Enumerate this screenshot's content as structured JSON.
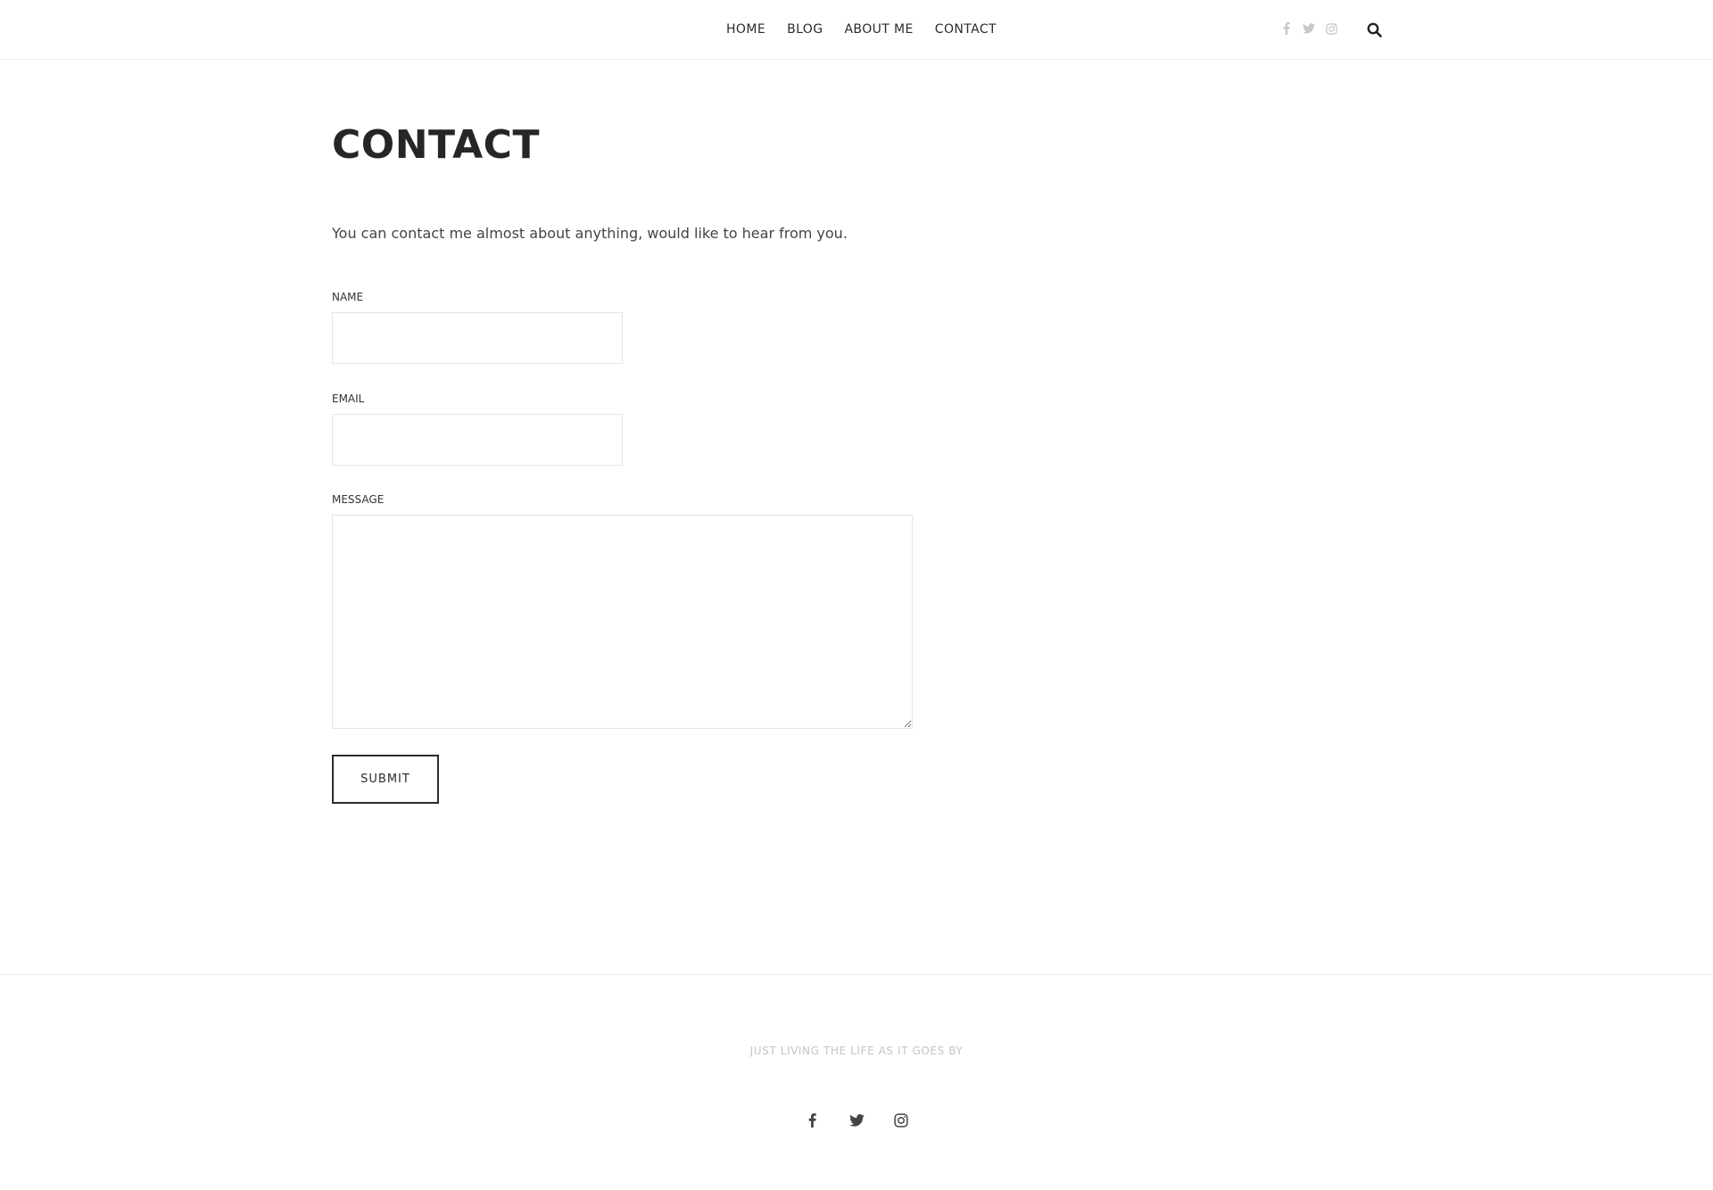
{
  "header": {
    "nav": [
      {
        "label": "HOME"
      },
      {
        "label": "BLOG"
      },
      {
        "label": "ABOUT ME"
      },
      {
        "label": "CONTACT"
      }
    ],
    "social_icons": [
      "facebook-icon",
      "twitter-icon",
      "instagram-icon"
    ],
    "search_icon": "search-icon"
  },
  "main": {
    "title": "CONTACT",
    "intro": "You can contact me almost about anything, would like to hear from you.",
    "form": {
      "name_label": "NAME",
      "name_value": "",
      "email_label": "EMAIL",
      "email_value": "",
      "message_label": "MESSAGE",
      "message_value": "",
      "submit_label": "SUBMIT"
    }
  },
  "footer": {
    "tagline": "JUST LIVING THE LIFE AS IT GOES BY",
    "social_icons": [
      "facebook-icon",
      "twitter-icon",
      "instagram-icon"
    ]
  },
  "colors": {
    "text": "#2b2b2b",
    "border": "#e5e5e5",
    "muted": "#c4c4c4",
    "social_top": "#c8c8c8"
  }
}
